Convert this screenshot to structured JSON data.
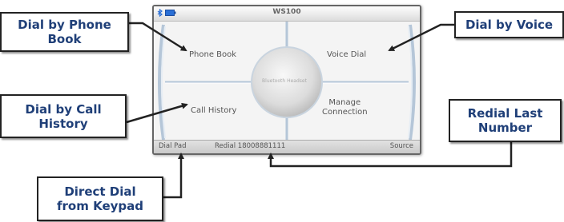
{
  "callouts": {
    "dial_by_phone_book": "Dial by Phone\nBook",
    "dial_by_voice": "Dial by Voice",
    "dial_by_call_history": "Dial by Call\nHistory",
    "redial_last_number": "Redial Last\nNumber",
    "direct_dial_from_keypad": "Direct Dial\nfrom Keypad"
  },
  "device": {
    "title": "WS100",
    "menu": {
      "phone_book": "Phone Book",
      "voice_dial": "Voice Dial",
      "call_history": "Call History",
      "manage_connection": "Manage\nConnection",
      "center": "Bluetooth Headset"
    },
    "softkeys": {
      "dial_pad": "Dial Pad",
      "redial": "Redial 18008881111",
      "source": "Source"
    }
  },
  "colors": {
    "callout_text": "#1f3f78",
    "callout_border": "#222222",
    "status_icon": "#2a6fd6"
  },
  "icons": [
    "bluetooth-icon",
    "battery-icon"
  ]
}
